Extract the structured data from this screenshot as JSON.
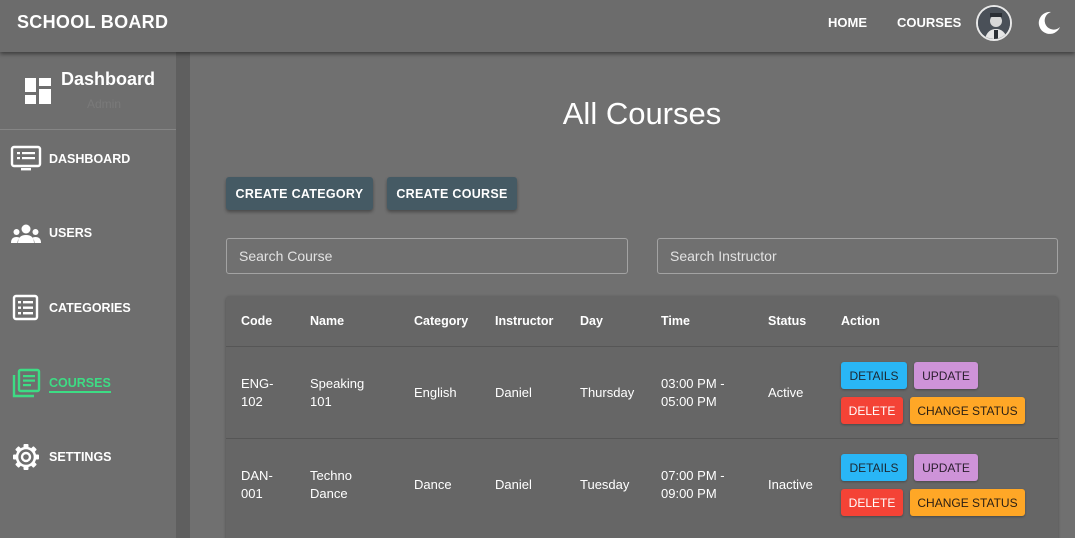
{
  "header": {
    "brand": "SCHOOL BOARD",
    "nav": [
      "HOME",
      "COURSES"
    ]
  },
  "sidebar": {
    "title": "Dashboard",
    "subtitle": "Admin",
    "items": [
      {
        "label": "DASHBOARD",
        "icon": "monitor-icon"
      },
      {
        "label": "USERS",
        "icon": "users-icon"
      },
      {
        "label": "CATEGORIES",
        "icon": "list-icon"
      },
      {
        "label": "COURSES",
        "icon": "library-icon",
        "active": true
      },
      {
        "label": "SETTINGS",
        "icon": "gear-icon"
      }
    ],
    "active_color": "#3ddc84"
  },
  "main": {
    "title": "All Courses",
    "create_category_label": "CREATE CATEGORY",
    "create_course_label": "CREATE COURSE",
    "search_course_placeholder": "Search Course",
    "search_instructor_placeholder": "Search Instructor"
  },
  "table": {
    "columns": [
      "Code",
      "Name",
      "Category",
      "Instructor",
      "Day",
      "Time",
      "Status",
      "Action"
    ],
    "rows": [
      {
        "code": [
          "ENG-",
          "102"
        ],
        "name": [
          "Speaking",
          "101"
        ],
        "category": "English",
        "instructor": "Daniel",
        "day": "Thursday",
        "time": [
          "03:00 PM -",
          "05:00 PM"
        ],
        "status": "Active"
      },
      {
        "code": [
          "DAN-",
          "001"
        ],
        "name": [
          "Techno",
          "Dance"
        ],
        "category": "Dance",
        "instructor": "Daniel",
        "day": "Tuesday",
        "time": [
          "07:00 PM -",
          "09:00 PM"
        ],
        "status": "Inactive"
      }
    ],
    "actions": {
      "details": "DETAILS",
      "update": "UPDATE",
      "delete": "DELETE",
      "change_status": "CHANGE STATUS"
    }
  },
  "colors": {
    "details": "#29b6f6",
    "update": "#ce93d8",
    "delete": "#f44336",
    "change_status": "#ffa726",
    "primary_button": "#455a64"
  }
}
